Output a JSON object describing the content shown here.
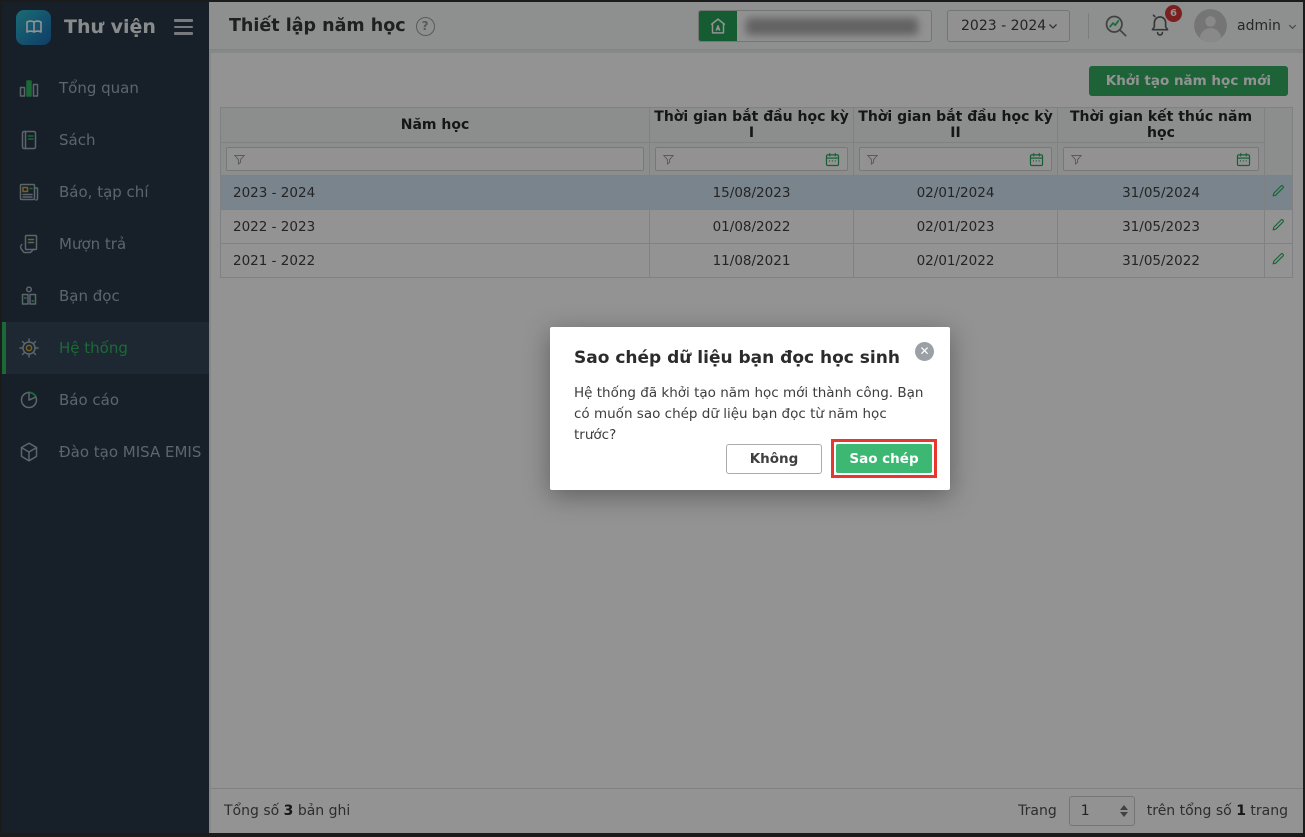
{
  "sidebar": {
    "app_title": "Thư viện",
    "items": [
      {
        "label": "Tổng quan",
        "icon": "bar-chart-icon"
      },
      {
        "label": "Sách",
        "icon": "book-icon"
      },
      {
        "label": "Báo, tạp chí",
        "icon": "newspaper-icon"
      },
      {
        "label": "Mượn trả",
        "icon": "borrow-return-icon"
      },
      {
        "label": "Bạn đọc",
        "icon": "reader-icon"
      },
      {
        "label": "Hệ thống",
        "icon": "gear-icon",
        "active": true
      },
      {
        "label": "Báo cáo",
        "icon": "pie-chart-icon"
      },
      {
        "label": "Đào tạo MISA EMIS",
        "icon": "cube-icon"
      }
    ]
  },
  "header": {
    "page_title": "Thiết lập năm học",
    "school_name_redacted": true,
    "school_year_selected": "2023 - 2024",
    "notification_count": "6",
    "username": "admin"
  },
  "toolbar": {
    "create_year_button": "Khởi tạo năm học mới"
  },
  "table": {
    "columns": [
      "Năm học",
      "Thời gian bắt đầu học kỳ I",
      "Thời gian bắt đầu học kỳ II",
      "Thời gian kết thúc năm học"
    ],
    "rows": [
      {
        "nam_hoc": "2023 - 2024",
        "hoc_ky_1": "15/08/2023",
        "hoc_ky_2": "02/01/2024",
        "ket_thuc": "31/05/2024",
        "selected": true
      },
      {
        "nam_hoc": "2022 - 2023",
        "hoc_ky_1": "01/08/2022",
        "hoc_ky_2": "02/01/2023",
        "ket_thuc": "31/05/2023",
        "selected": false
      },
      {
        "nam_hoc": "2021 - 2022",
        "hoc_ky_1": "11/08/2021",
        "hoc_ky_2": "02/01/2022",
        "ket_thuc": "31/05/2022",
        "selected": false
      }
    ]
  },
  "footer": {
    "total_prefix": "Tổng số",
    "total_count": "3",
    "total_suffix": "bản ghi",
    "page_label": "Trang",
    "page_value": "1",
    "pages_prefix": "trên tổng số",
    "pages_count": "1",
    "pages_suffix": "trang"
  },
  "modal": {
    "title": "Sao chép dữ liệu bạn đọc học sinh",
    "message": "Hệ thống đã khởi tạo năm học mới thành công. Bạn có muốn sao chép dữ liệu bạn đọc từ năm học trước?",
    "decline_button": "Không",
    "confirm_button": "Sao chép",
    "close_glyph": "✕"
  },
  "colors": {
    "accent_green": "#2fa95c",
    "modal_confirm_green": "#3cb873",
    "sidebar_bg": "#223040",
    "active_item_green": "#2bb55e",
    "annotation_red": "#e7372e",
    "badge_red": "#d63330",
    "selected_row_blue": "#d3e5f2"
  }
}
